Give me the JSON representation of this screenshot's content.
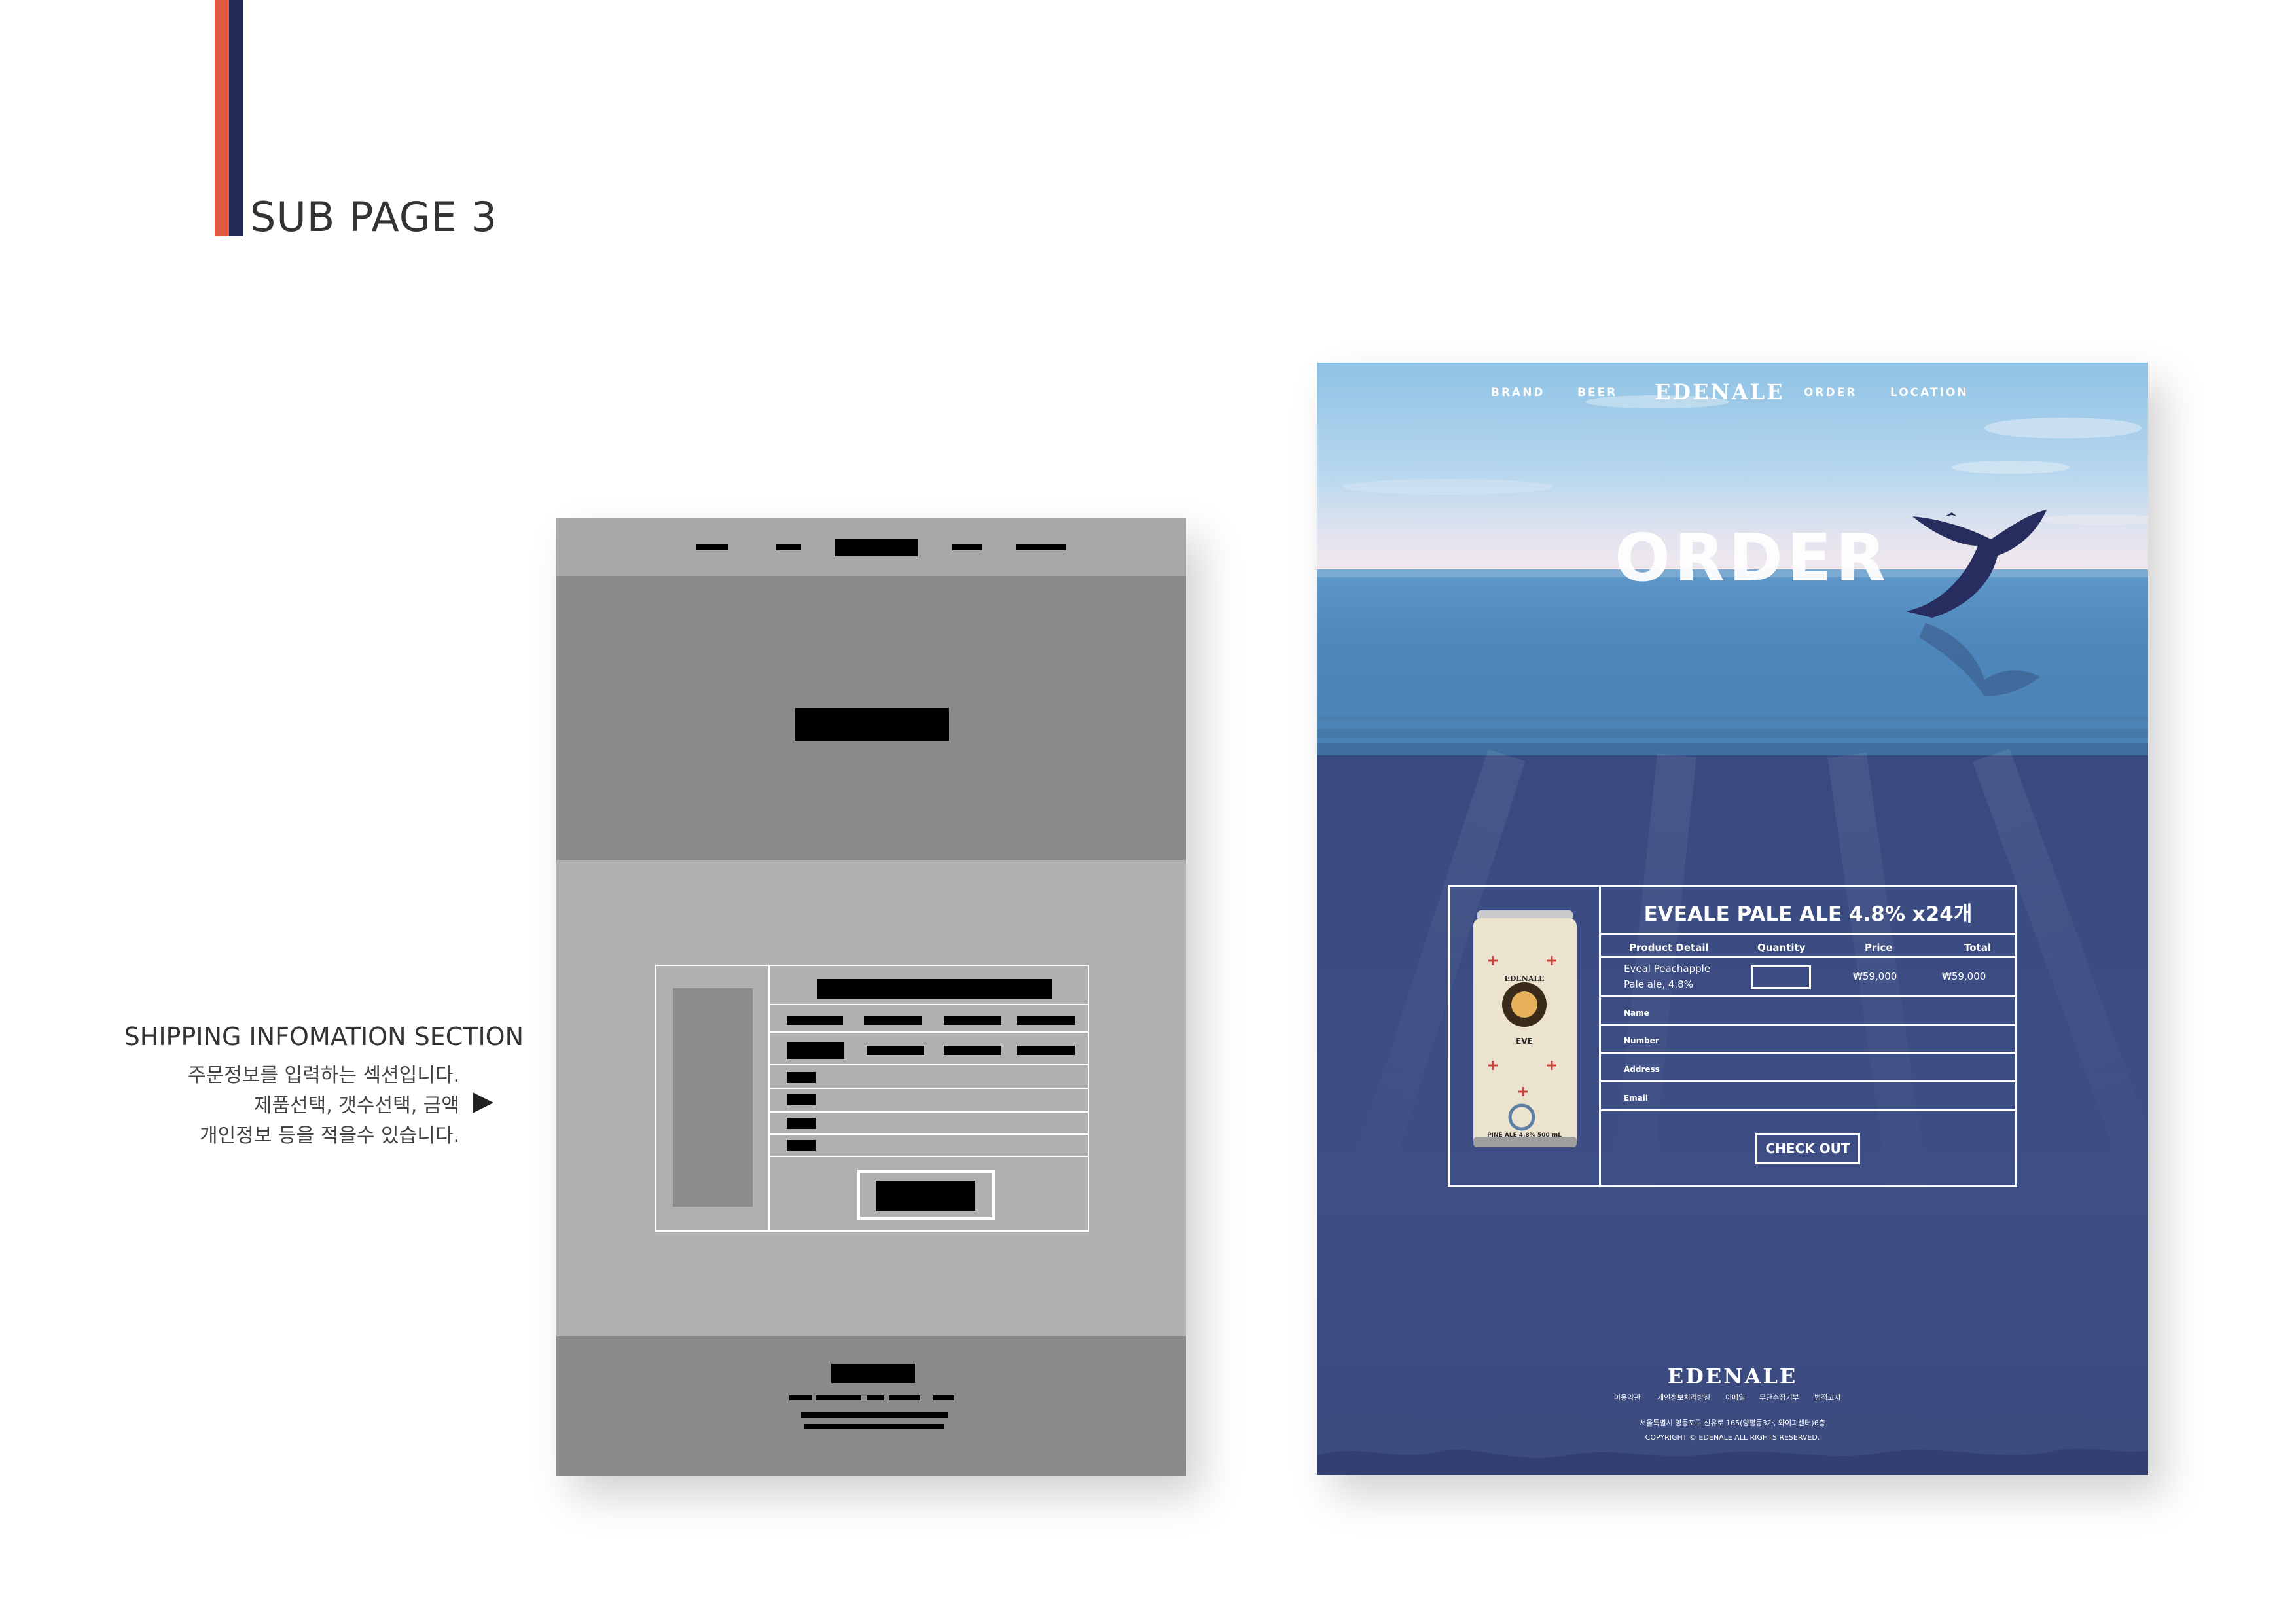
{
  "section": {
    "title": "SUB PAGE 3"
  },
  "description": {
    "title": "SHIPPING INFOMATION SECTION",
    "lines": [
      "주문정보를 입력하는 섹션입니다.",
      "제품선택, 갯수선택, 금액",
      "개인정보 등을 적을수 있습니다."
    ]
  },
  "mockup": {
    "nav": {
      "brand": "BRAND",
      "beer": "BEER",
      "logo": "EDENALE",
      "order": "ORDER",
      "location": "LOCATION"
    },
    "hero": {
      "title": "ORDER"
    },
    "order": {
      "product_title": "EVEALE PALE ALE 4.8% x24개",
      "columns": [
        "Product Detail",
        "Quantity",
        "Price",
        "Total"
      ],
      "product_line1": "Eveal Peachapple",
      "product_line2": "Pale ale, 4.8%",
      "price": "₩59,000",
      "total": "₩59,000",
      "fields": [
        "Name",
        "Number",
        "Address",
        "Email"
      ],
      "checkout_label": "CHECK OUT"
    },
    "can": {
      "brand": "EDENALE",
      "label": "EVE",
      "bottom": "PINE ALE 4.8% 500 mL"
    },
    "footer": {
      "logo": "EDENALE",
      "menu": [
        "이용약관",
        "개인정보처리방침",
        "이메일",
        "무단수집거부",
        "법적고지"
      ],
      "address": "서울특별시 영등포구 선유로 165(양평동3가, 와이피센터)6층",
      "copyright": "COPYRIGHT © EDENALE ALL RIGHTS RESERVED."
    }
  },
  "colors": {
    "accent_red": "#e05a43",
    "accent_navy": "#222a55",
    "deep_sea": "#3a4a7e"
  }
}
